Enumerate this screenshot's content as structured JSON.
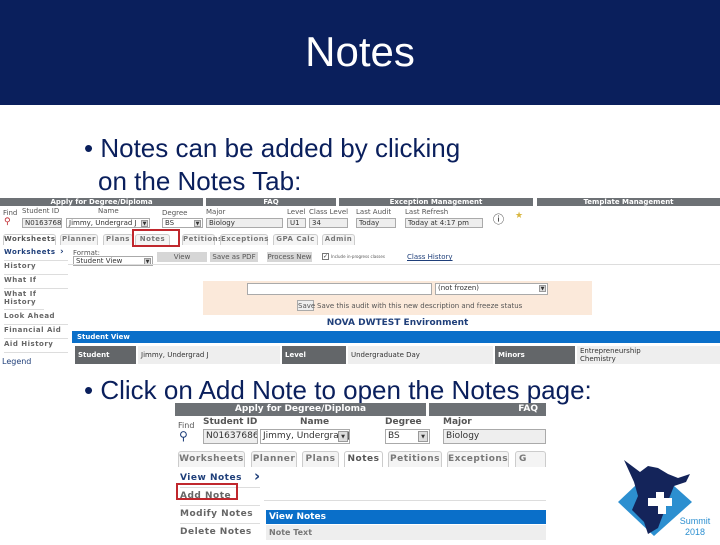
{
  "slide": {
    "title": "Notes",
    "bullet1_line1": "• Notes can be added by clicking",
    "bullet1_line2": "on the Notes Tab:",
    "bullet2": "• Click on Add Note to open the Notes page:"
  },
  "shot1": {
    "header_bars": [
      "Apply for Degree/Diploma",
      "FAQ",
      "Exception Management",
      "Template Management"
    ],
    "fields": {
      "find": "Find",
      "student_id_label": "Student ID",
      "student_id": "N01637686",
      "name_label": "Name",
      "name": "Jimmy, Undergrad J",
      "degree_label": "Degree",
      "degree": "BS",
      "major_label": "Major",
      "major": "Biology",
      "level_label": "Level",
      "level": "U1",
      "class_level_label": "Class Level",
      "class_level": "34",
      "last_audit_label": "Last Audit",
      "last_audit": "Today",
      "last_refresh_label": "Last Refresh",
      "last_refresh": "Today at 4:17 pm"
    },
    "tabs": [
      "Worksheets",
      "Planner",
      "Plans",
      "Notes",
      "Petitions",
      "Exceptions",
      "GPA Calc",
      "Admin"
    ],
    "nav": [
      "Worksheets",
      "History",
      "What If",
      "What If History",
      "Look Ahead",
      "Financial Aid",
      "Aid History"
    ],
    "legend": "Legend",
    "format_label": "Format:",
    "format_value": "Student View",
    "buttons": {
      "view": "View",
      "save_pdf": "Save as PDF",
      "process_new": "Process New"
    },
    "include_label": "Include in-progress classes",
    "class_history": "Class History",
    "freeze_select": "(not frozen)",
    "save": "Save",
    "save_text": "Save this audit with this new description and freeze status",
    "environment": "NOVA DWTEST Environment",
    "student_view": "Student View",
    "row": {
      "student_h": "Student",
      "student": "Jimmy, Undergrad J",
      "level_h": "Level",
      "level": "Undergraduate Day",
      "minors_h": "Minors",
      "minors1": "Entrepreneurship",
      "minors2": "Chemistry"
    }
  },
  "shot2": {
    "header_bars": [
      "Apply for Degree/Diploma",
      "FAQ"
    ],
    "fields": {
      "find": "Find",
      "student_id_label": "Student ID",
      "student_id": "N01637686",
      "name_label": "Name",
      "name": "Jimmy, Undergrad J",
      "degree_label": "Degree",
      "degree": "BS",
      "major_label": "Major",
      "major": "Biology"
    },
    "tabs": [
      "Worksheets",
      "Planner",
      "Plans",
      "Notes",
      "Petitions",
      "Exceptions",
      "G"
    ],
    "nav": [
      "View Notes",
      "Add Note",
      "Modify Notes",
      "Delete Notes"
    ],
    "view_notes_bar": "View Notes",
    "note_text": "Note Text"
  },
  "logo": {
    "line1": "Summit",
    "line2": "2018"
  },
  "colors": {
    "title_bg": "#0a1f5c",
    "highlight": "#c0272d",
    "blue_bar": "#0a6fc9"
  }
}
